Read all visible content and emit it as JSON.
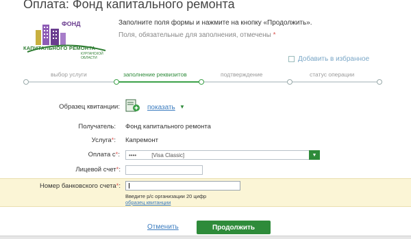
{
  "page": {
    "title": "Оплата: Фонд капитального ремонта",
    "instruction": "Заполните поля формы и нажмите на кнопку «Продолжить».",
    "required_note": "Поля, обязательные для заполнения, отмечены",
    "required_star": "*"
  },
  "logo": {
    "line1": "ФОНД",
    "line2": "КАПИТАЛЬНОГО РЕМОНТА",
    "line3": "КУРГАНСКОЙ ОБЛАСТИ",
    "colors": {
      "purple": "#6a3d8f",
      "green": "#2e7d32"
    }
  },
  "favorite": {
    "label": "Добавить в избранное"
  },
  "steps": [
    {
      "label": "выбор услуги",
      "state": "done"
    },
    {
      "label": "заполнение реквизитов",
      "state": "active"
    },
    {
      "label": "подтверждение",
      "state": "pending"
    },
    {
      "label": "статус операции",
      "state": "pending"
    }
  ],
  "form": {
    "sample": {
      "label": "Образец квитанции:",
      "link": "показать"
    },
    "recipient": {
      "label": "Получатель:",
      "value": "Фонд капитального ремонта"
    },
    "service": {
      "label": "Услуга",
      "value": "Капремонт"
    },
    "pay_from": {
      "label": "Оплата с",
      "mask": "••••",
      "card_type": "[Visa Classic]"
    },
    "personal_account": {
      "label": "Лицевой счет",
      "value": ""
    },
    "bank_account": {
      "label": "Номер банковского счета",
      "value": "",
      "hint": "Введите р/с организации 20 цифр",
      "sample_link": "образец квитанции"
    },
    "required_star": "*",
    "colon": ":"
  },
  "actions": {
    "cancel": "Отменить",
    "continue": "Продолжить"
  },
  "colors": {
    "accent_green": "#2e8b3a",
    "link_blue": "#3a7bbf",
    "required_red": "#d9534f",
    "highlight_band": "#fbf5d6"
  }
}
